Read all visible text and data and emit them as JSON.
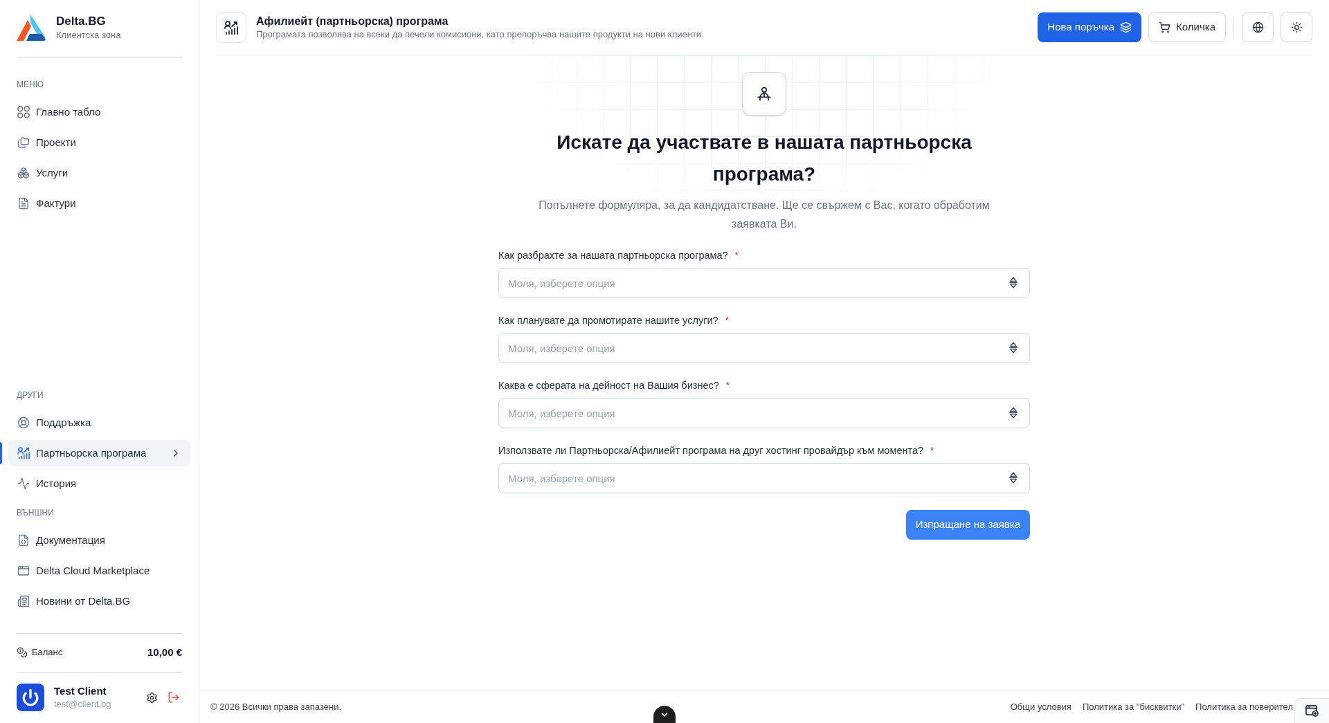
{
  "sidebar": {
    "brand": {
      "name": "Delta.BG",
      "subtitle": "Клиентска зона"
    },
    "sections": [
      {
        "title": "МЕНЮ",
        "items": [
          {
            "label": "Главно табло",
            "selected": false
          },
          {
            "label": "Проекти",
            "selected": false
          },
          {
            "label": "Услуги",
            "selected": false
          },
          {
            "label": "Фактури",
            "selected": false
          }
        ]
      },
      {
        "title": "ДРУГИ",
        "items": [
          {
            "label": "Поддръжка",
            "selected": false
          },
          {
            "label": "Партньорска програма",
            "selected": true
          },
          {
            "label": "История",
            "selected": false
          }
        ]
      },
      {
        "title": "ВЪНШНИ",
        "items": [
          {
            "label": "Документация",
            "selected": false
          },
          {
            "label": "Delta Cloud Marketplace",
            "selected": false
          },
          {
            "label": "Новини от Delta.BG",
            "selected": false
          }
        ]
      }
    ],
    "balance": {
      "label": "Баланс",
      "amount": "10,00 €"
    },
    "user": {
      "name": "Test Client",
      "email": "test@client.bg"
    }
  },
  "header": {
    "title": "Афилиейт (партньорска) програма",
    "subtitle": "Програмата позволява на всеки да печели комисиони, като препоръчва нашите продукти на нови клиенти.",
    "buttons": [
      {
        "label": "Нова поръчка",
        "kind": "primary"
      },
      {
        "label": "Количка",
        "kind": "secondary"
      }
    ]
  },
  "form": {
    "heading": "Искате да участвате в нашата партньорска програма?",
    "description": "Попълнете формуляра, за да кандидатстване. Ще се свържем с Вас, когато обработим заявката Ви.",
    "fields": [
      {
        "label": "Как разбрахте за нашата партньорска програма?",
        "required_mark": "*",
        "placeholder": "Моля, изберете опция"
      },
      {
        "label": "Как планувате да промотирате нашите услуги?",
        "required_mark": "*",
        "placeholder": "Моля, изберете опция"
      },
      {
        "label": "Каква е сферата на дейност на Вашия бизнес?",
        "required_mark": "*",
        "placeholder": "Моля, изберете опция"
      },
      {
        "label": "Използвате ли Партньорска/Афилиейт програма на друг хостинг провайдър към момента?",
        "required_mark": "*",
        "placeholder": "Моля, изберете опция"
      }
    ],
    "submit": "Изпращане на заявка"
  },
  "footer": {
    "copyright": "© 2026 Всички права запазени.",
    "links": [
      "Общи условия",
      "Политика за \"бисквитки\"",
      "Политика за поверител"
    ]
  }
}
